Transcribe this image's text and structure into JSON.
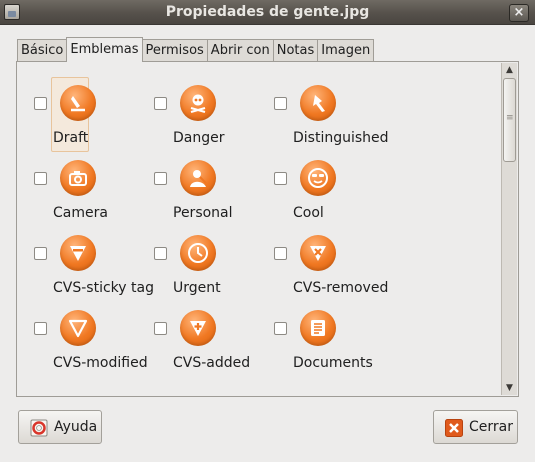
{
  "window": {
    "title": "Propiedades de gente.jpg",
    "close_glyph": "×"
  },
  "tabs": [
    {
      "label": "Básico"
    },
    {
      "label": "Emblemas"
    },
    {
      "label": "Permisos"
    },
    {
      "label": "Abrir con"
    },
    {
      "label": "Notas"
    },
    {
      "label": "Imagen"
    }
  ],
  "active_tab": "Emblemas",
  "emblems": [
    {
      "label": "Draft",
      "icon": "draft-icon",
      "checked": false,
      "selected": true
    },
    {
      "label": "Danger",
      "icon": "danger-icon",
      "checked": false
    },
    {
      "label": "Distinguished",
      "icon": "distinguished-icon",
      "checked": false
    },
    {
      "label": "Camera",
      "icon": "camera-icon",
      "checked": false
    },
    {
      "label": "Personal",
      "icon": "personal-icon",
      "checked": false
    },
    {
      "label": "Cool",
      "icon": "cool-icon",
      "checked": false
    },
    {
      "label": "CVS-sticky tag",
      "icon": "cvs-sticky-tag-icon",
      "checked": false
    },
    {
      "label": "Urgent",
      "icon": "urgent-icon",
      "checked": false
    },
    {
      "label": "CVS-removed",
      "icon": "cvs-removed-icon",
      "checked": false
    },
    {
      "label": "CVS-modified",
      "icon": "cvs-modified-icon",
      "checked": false
    },
    {
      "label": "CVS-added",
      "icon": "cvs-added-icon",
      "checked": false
    },
    {
      "label": "Documents",
      "icon": "documents-icon",
      "checked": false
    }
  ],
  "buttons": {
    "help_label": "Ayuda",
    "close_label": "Cerrar"
  },
  "colors": {
    "emblem_orange": "#f07822",
    "close_icon_red": "#e05a1c"
  }
}
